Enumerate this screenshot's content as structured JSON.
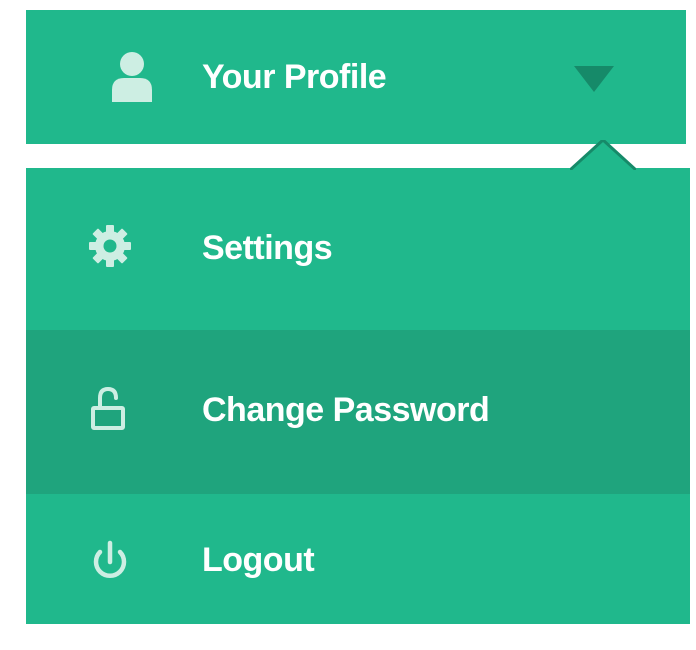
{
  "header": {
    "label": "Your Profile",
    "user_icon": "user-icon",
    "caret_icon": "caret-down-icon"
  },
  "menu": {
    "items": [
      {
        "label": "Settings",
        "icon": "gear-icon"
      },
      {
        "label": "Change Password",
        "icon": "lock-open-icon",
        "hovered": true
      },
      {
        "label": "Logout",
        "icon": "power-icon"
      }
    ]
  },
  "colors": {
    "accent": "#20b88c",
    "hover": "#1fa47d",
    "caret": "#168a69",
    "icon": "#cdeee3",
    "text": "#ffffff"
  }
}
